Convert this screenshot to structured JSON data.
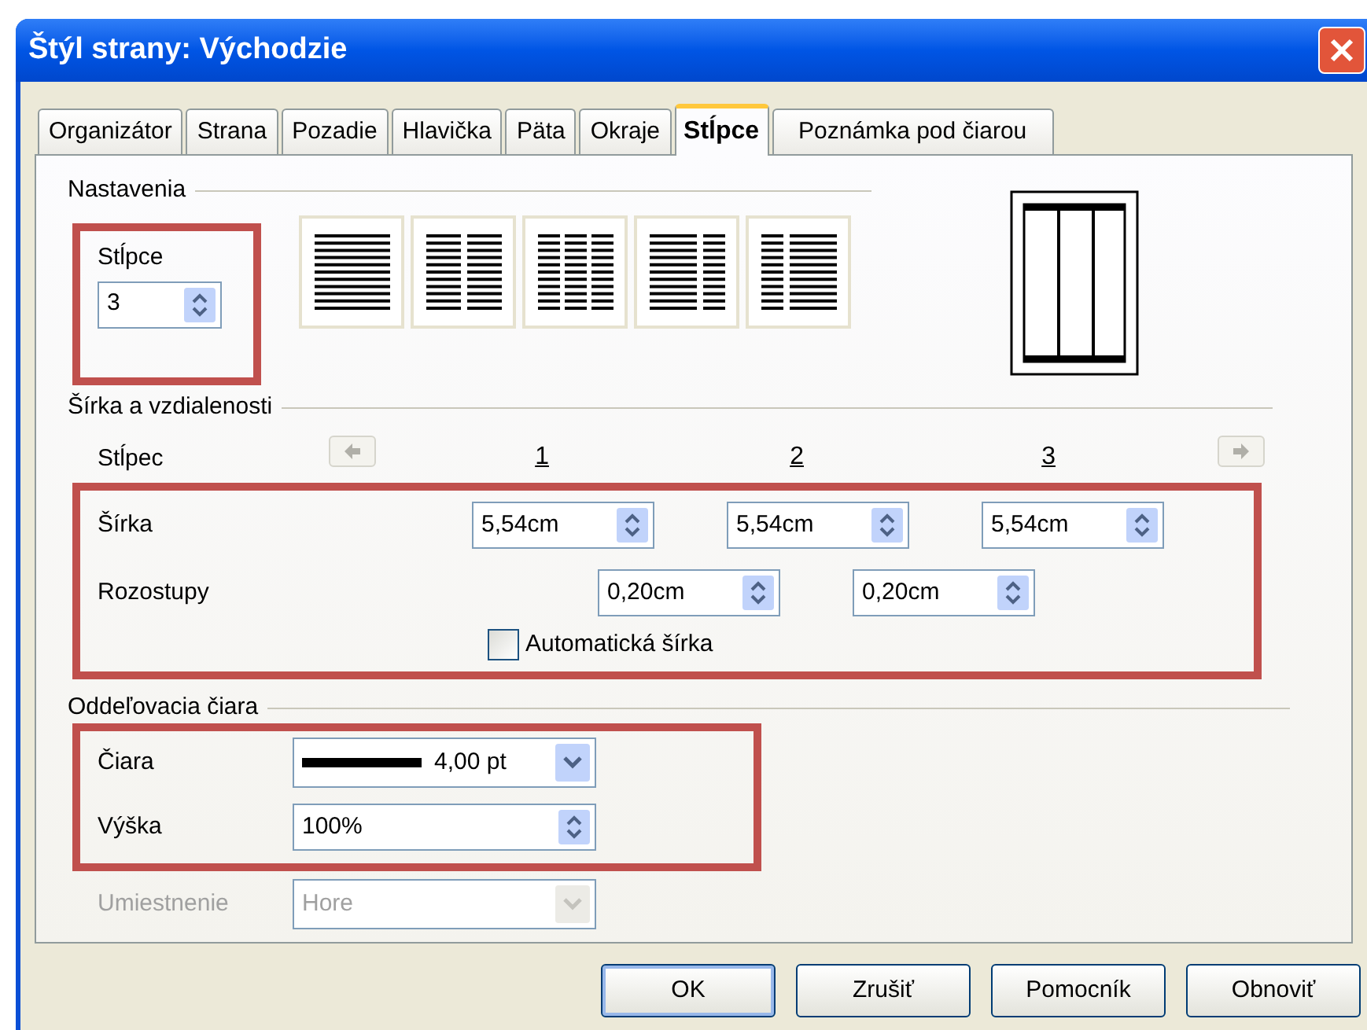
{
  "window": {
    "title": "Štýl strany: Východzie"
  },
  "tabs": [
    {
      "label": "Organizátor",
      "selected": false
    },
    {
      "label": "Strana",
      "selected": false
    },
    {
      "label": "Pozadie",
      "selected": false
    },
    {
      "label": "Hlavička",
      "selected": false
    },
    {
      "label": "Päta",
      "selected": false
    },
    {
      "label": "Okraje",
      "selected": false
    },
    {
      "label": "Stĺpce",
      "selected": true
    },
    {
      "label": "Poznámka pod čiarou",
      "selected": false
    }
  ],
  "settings": {
    "heading": "Nastavenia",
    "columns_label": "Stĺpce",
    "columns_value": "3",
    "layouts": [
      {
        "kind": "one"
      },
      {
        "kind": "two"
      },
      {
        "kind": "three"
      },
      {
        "kind": "left"
      },
      {
        "kind": "right"
      }
    ]
  },
  "width_spacing": {
    "heading": "Šírka a vzdialenosti",
    "column_label": "Stĺpec",
    "nav": [
      {
        "disabled": true
      },
      {
        "disabled": true
      }
    ],
    "column_numbers": [
      "1",
      "2",
      "3"
    ],
    "width_label": "Šírka",
    "widths": [
      "5,54cm",
      "5,54cm",
      "5,54cm"
    ],
    "spacing_label": "Rozostupy",
    "spacings": [
      "0,20cm",
      "0,20cm"
    ],
    "auto_width": {
      "label": "Automatická šírka",
      "checked": false
    }
  },
  "separator": {
    "heading": "Oddeľovacia čiara",
    "line_label": "Čiara",
    "line_value": "4,00 pt",
    "height_label": "Výška",
    "height_value": "100%",
    "position": {
      "label": "Umiestnenie",
      "value": "Hore",
      "disabled": true
    }
  },
  "buttons": [
    {
      "label": "OK",
      "default": true
    },
    {
      "label": "Zrušiť",
      "default": false
    },
    {
      "label": "Pomocník",
      "default": false
    },
    {
      "label": "Obnoviť",
      "default": false
    }
  ]
}
